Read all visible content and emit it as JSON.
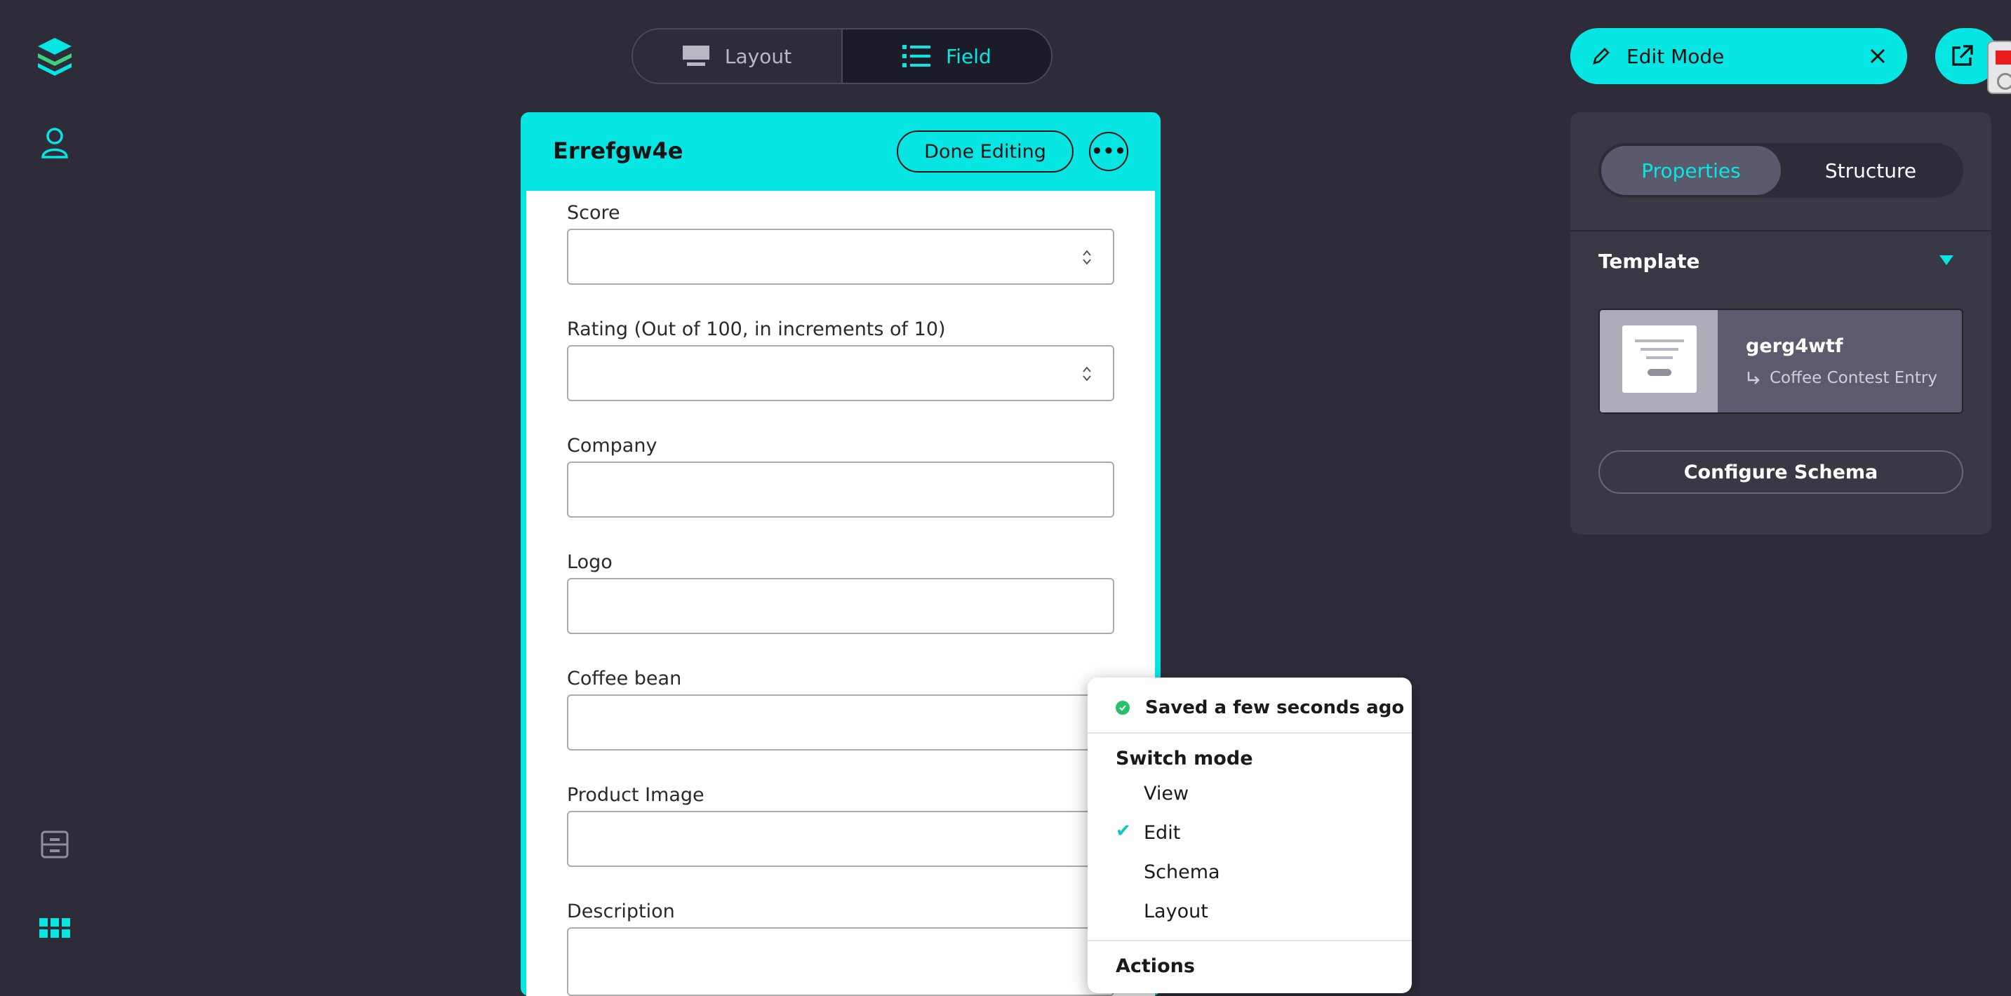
{
  "view_toggle": {
    "layout_label": "Layout",
    "field_label": "Field",
    "active": "Field"
  },
  "edit_mode": {
    "label": "Edit Mode"
  },
  "card": {
    "title": "Errefgw4e",
    "done_label": "Done Editing",
    "more_label": "•••",
    "fields": [
      {
        "label": "Score",
        "type": "number"
      },
      {
        "label": "Rating (Out of 100, in increments of 10)",
        "type": "number"
      },
      {
        "label": "Company",
        "type": "text"
      },
      {
        "label": "Logo",
        "type": "text"
      },
      {
        "label": "Coffee bean",
        "type": "text"
      },
      {
        "label": "Product Image",
        "type": "text"
      },
      {
        "label": "Description",
        "type": "text"
      }
    ]
  },
  "panel": {
    "tabs": [
      "Properties",
      "Structure"
    ],
    "active_tab": "Properties",
    "template_heading": "Template",
    "template_name": "gerg4wtf",
    "template_parent": "Coffee Contest Entry",
    "configure_label": "Configure Schema"
  },
  "menu": {
    "saved_status": "Saved a few seconds ago",
    "switch_heading": "Switch mode",
    "modes": [
      "View",
      "Edit",
      "Schema",
      "Layout"
    ],
    "selected_mode": "Edit",
    "actions_heading": "Actions"
  },
  "colors": {
    "accent": "#08e6e4",
    "background": "#2d2c38",
    "panel": "#393945",
    "success": "#26c06a"
  }
}
